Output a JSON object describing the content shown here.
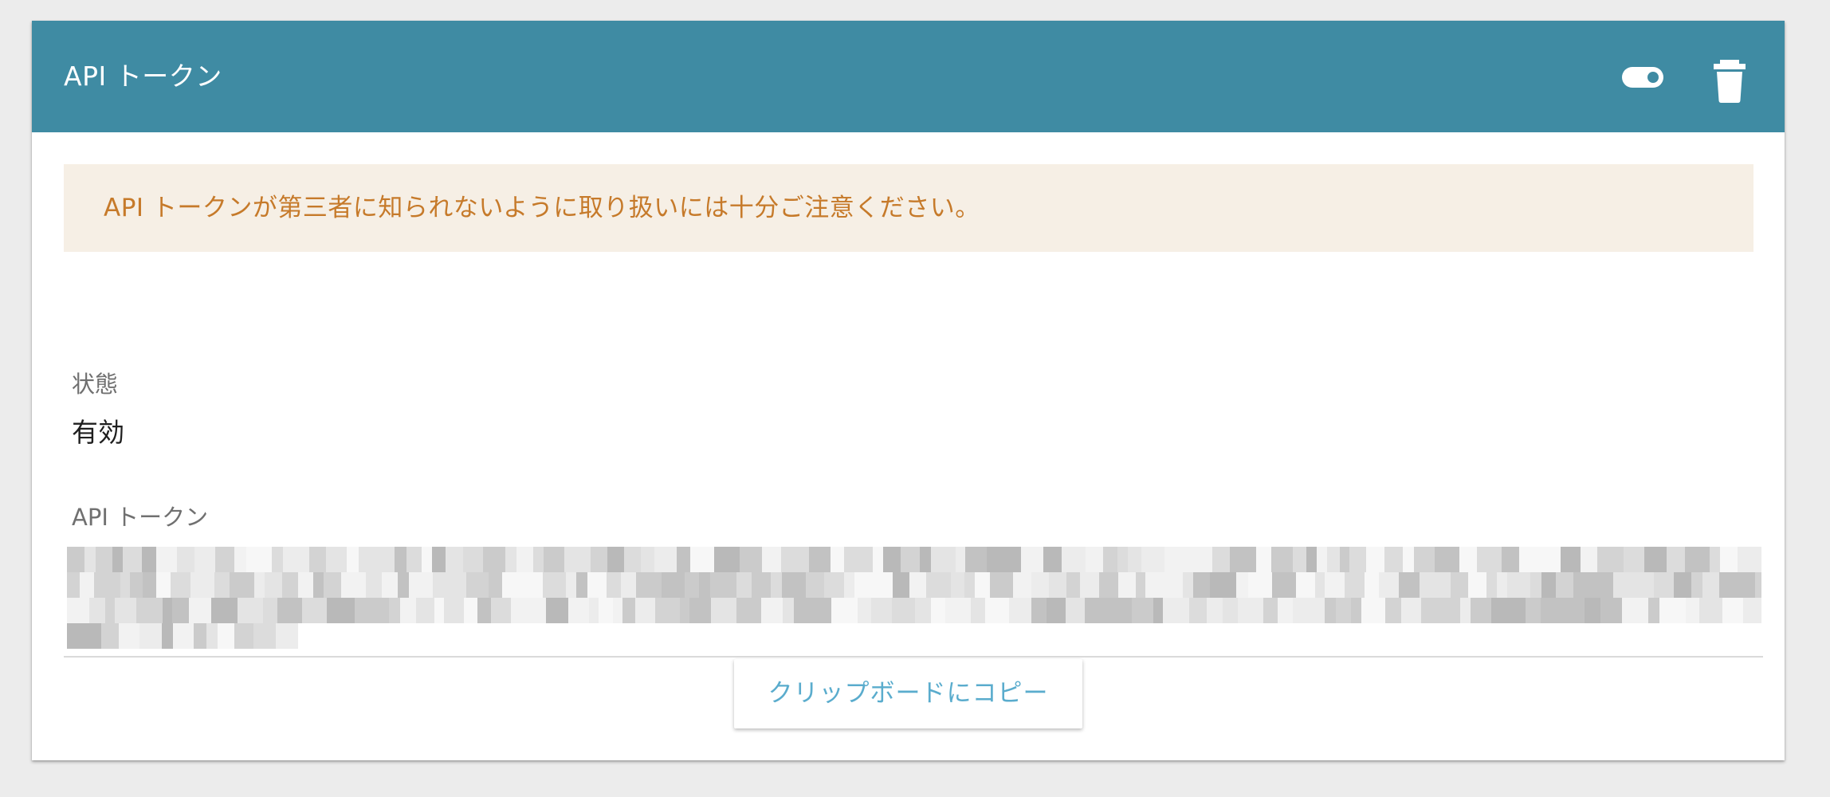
{
  "card": {
    "title": "API トークン",
    "toggle_icon": "toggle-on-icon",
    "delete_icon": "trash-icon"
  },
  "alert": {
    "message": "API トークンが第三者に知られないように取り扱いには十分ご注意ください。"
  },
  "status": {
    "label": "状態",
    "value": "有効"
  },
  "token": {
    "label": "API トークン",
    "obscured": true
  },
  "copy_button": {
    "label": "クリップボードにコピー"
  },
  "colors": {
    "header": "#3f8ba3",
    "alert_bg": "#f6efe5",
    "alert_text": "#c67a2a",
    "button_text": "#5aaccd"
  }
}
